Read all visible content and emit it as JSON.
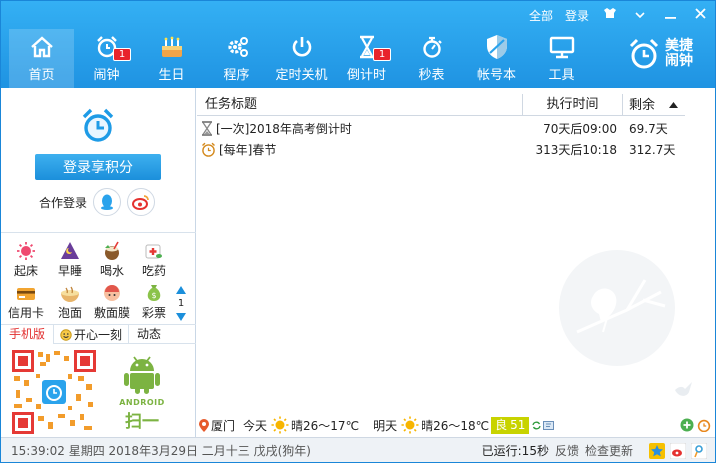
{
  "topbar": {
    "all": "全部",
    "login": "登录"
  },
  "nav": [
    {
      "label": "首页",
      "icon": "home-icon",
      "active": true
    },
    {
      "label": "闹钟",
      "icon": "alarm-clock-icon",
      "badge": "1"
    },
    {
      "label": "生日",
      "icon": "cake-icon"
    },
    {
      "label": "程序",
      "icon": "gear-icon"
    },
    {
      "label": "定时关机",
      "icon": "power-icon"
    },
    {
      "label": "倒计时",
      "icon": "hourglass-icon",
      "badge": "1"
    },
    {
      "label": "秒表",
      "icon": "stopwatch-icon"
    },
    {
      "label": "帐号本",
      "icon": "shield-icon"
    },
    {
      "label": "工具",
      "icon": "monitor-icon"
    }
  ],
  "brand": {
    "line1": "美捷",
    "line2": "闹钟"
  },
  "left": {
    "login_button": "登录享积分",
    "partner_label": "合作登录",
    "tools": [
      "起床",
      "早睡",
      "喝水",
      "吃药",
      "信用卡",
      "泡面",
      "敷面膜",
      "彩票"
    ],
    "page_num": "1",
    "tabs": [
      "手机版",
      "开心一刻",
      "动态"
    ],
    "qr_label": "扫一扫"
  },
  "list": {
    "headers": {
      "title": "任务标题",
      "time": "执行时间",
      "remain": "剩余"
    },
    "rows": [
      {
        "icon": "hourglass-icon",
        "title": "[一次]2018年高考倒计时",
        "time": "70天后09:00",
        "remain": "69.7天"
      },
      {
        "icon": "alarm-clock-icon",
        "title": "[每年]春节",
        "time": "313天后10:18",
        "remain": "312.7天"
      }
    ]
  },
  "weather": {
    "city": "厦门",
    "today_label": "今天",
    "today_weather": "晴26～17℃",
    "tomorrow_label": "明天",
    "tomorrow_weather": "晴26～18℃",
    "aqi_label": "良",
    "aqi_value": "51"
  },
  "status": {
    "datetime": "15:39:02 星期四 2018年3月29日 二月十三 戊戌(狗年)",
    "running": "已运行:15秒",
    "feedback": "反馈",
    "update": "检查更新"
  },
  "colors": {
    "header": "#2aa3ec",
    "accent": "#1b8fdb",
    "badge": "#e8232c",
    "aqi": "#c8d300"
  }
}
